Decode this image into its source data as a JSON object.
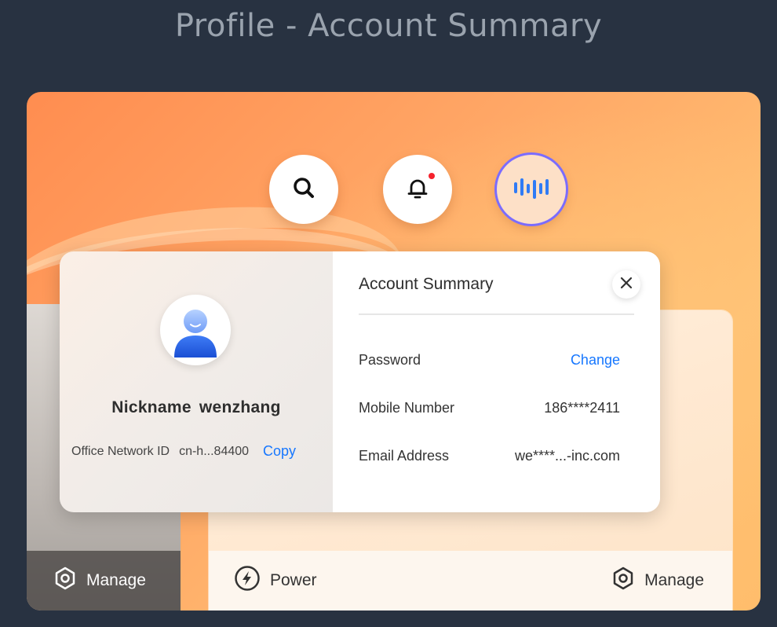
{
  "page_title": "Profile - Account Summary",
  "toolbar": {
    "search_icon": "search-icon",
    "notification_icon": "bell-icon",
    "notification_badge": true,
    "voice_icon": "voice-assistant-icon"
  },
  "profile": {
    "nickname_label": "Nickname",
    "nickname_value": "wenzhang",
    "office_network_label": "Office Network ID",
    "office_network_value": "cn-h...84400",
    "copy_label": "Copy"
  },
  "account_summary": {
    "title": "Account Summary",
    "rows": [
      {
        "label": "Password",
        "value": "Change",
        "is_link": true
      },
      {
        "label": "Mobile Number",
        "value": "186****2411",
        "is_link": false
      },
      {
        "label": "Email Address",
        "value": "we****...-inc.com",
        "is_link": false
      }
    ]
  },
  "bottom_bars": {
    "left_manage_label": "Manage",
    "power_label": "Power",
    "right_manage_label": "Manage"
  },
  "colors": {
    "accent_link": "#1677ff",
    "page_background": "#283241",
    "notification_dot": "#f5222d",
    "voice_ring": "#7b6cff"
  }
}
